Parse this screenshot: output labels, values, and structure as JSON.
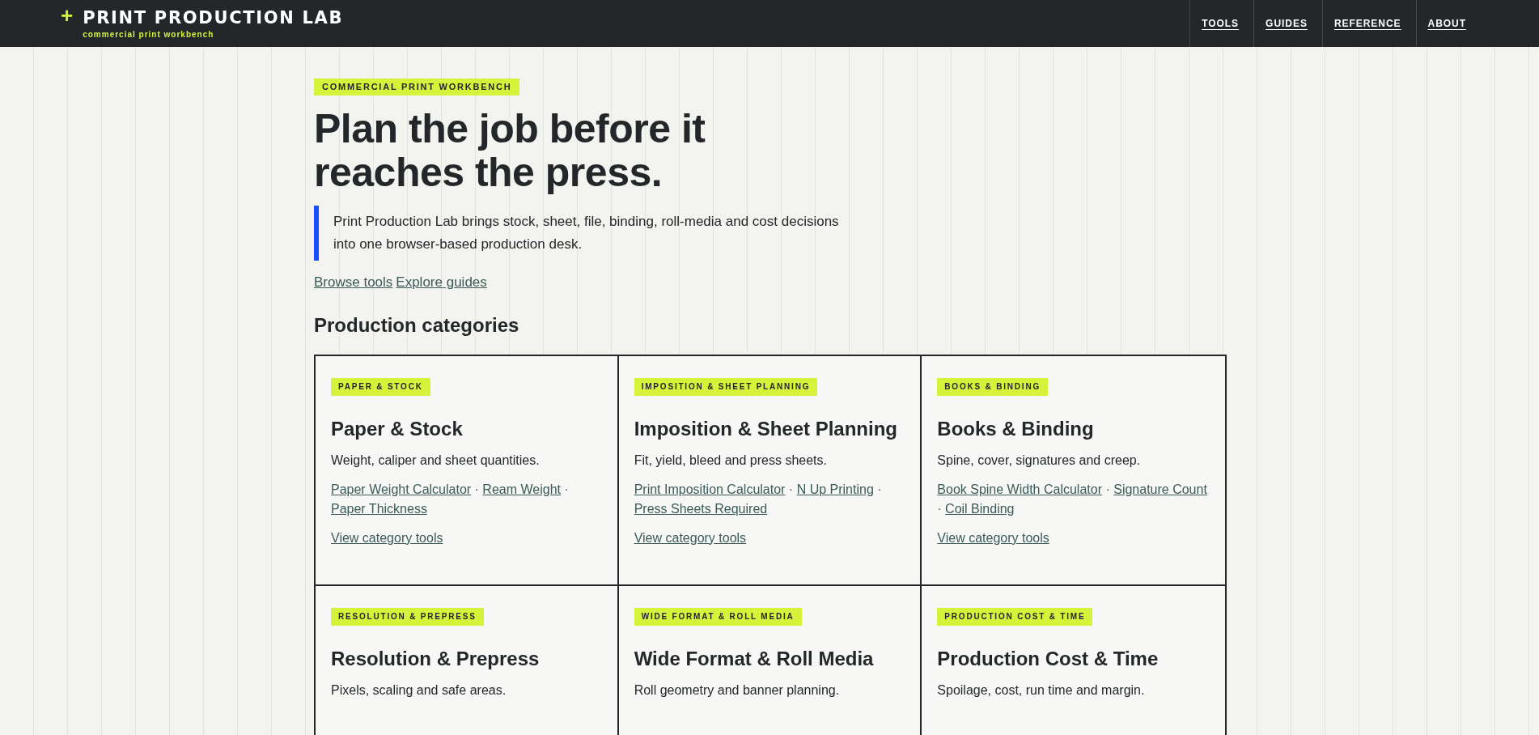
{
  "header": {
    "logo_mark": "+",
    "title": "PRINT PRODUCTION LAB",
    "tagline": "commercial print workbench",
    "nav": [
      "TOOLS",
      "GUIDES",
      "REFERENCE",
      "ABOUT"
    ]
  },
  "hero": {
    "badge": "COMMERCIAL PRINT WORKBENCH",
    "heading": "Plan the job before it reaches the press.",
    "intro": "Print Production Lab brings stock, sheet, file, binding, roll-media and cost decisions into one browser-based production desk.",
    "links": [
      "Browse tools",
      "Explore guides"
    ]
  },
  "categories_heading": "Production categories",
  "categories": [
    {
      "badge": "PAPER & STOCK",
      "title": "Paper & Stock",
      "description": "Weight, caliper and sheet quantities.",
      "links": [
        {
          "label": "Paper Weight Calculator",
          "separator": "·"
        },
        {
          "label": "Ream Weight",
          "separator": "·"
        },
        {
          "label": "Paper Thickness"
        }
      ],
      "more": "View category tools"
    },
    {
      "badge": "IMPOSITION & SHEET PLANNING",
      "title": "Imposition & Sheet Planning",
      "description": "Fit, yield, bleed and press sheets.",
      "links": [
        {
          "label": "Print Imposition Calculator",
          "separator": "·"
        },
        {
          "label": "N Up Printing",
          "separator": "·"
        },
        {
          "label": "Press Sheets Required"
        }
      ],
      "more": "View category tools"
    },
    {
      "badge": "BOOKS & BINDING",
      "title": "Books & Binding",
      "description": "Spine, cover, signatures and creep.",
      "links": [
        {
          "label": "Book Spine Width Calculator",
          "separator": "·"
        },
        {
          "label": "Signature Count",
          "separator": "·"
        },
        {
          "label": "Coil Binding"
        }
      ],
      "more": "View category tools"
    },
    {
      "badge": "RESOLUTION & PREPRESS",
      "title": "Resolution & Prepress",
      "description": "Pixels, scaling and safe areas."
    },
    {
      "badge": "WIDE FORMAT & ROLL MEDIA",
      "title": "Wide Format & Roll Media",
      "description": "Roll geometry and banner planning."
    },
    {
      "badge": "PRODUCTION COST & TIME",
      "title": "Production Cost & Time",
      "description": "Spoilage, cost, run time and margin."
    }
  ]
}
